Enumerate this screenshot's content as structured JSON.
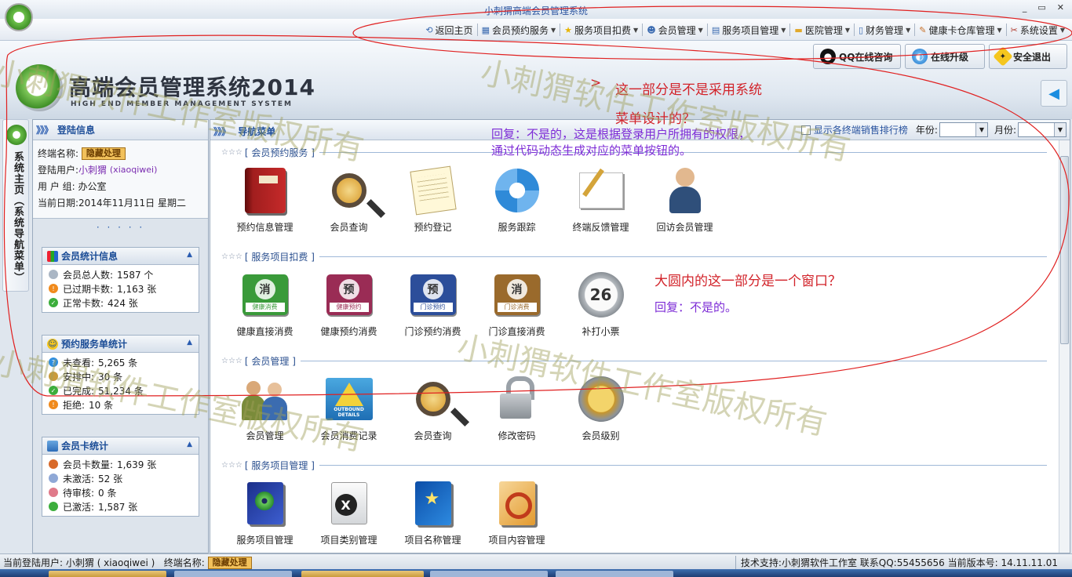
{
  "window": {
    "title": "小刺猬高端会员管理系统",
    "controls": [
      "_",
      "▭",
      "✕"
    ]
  },
  "menu": [
    {
      "label": "返回主页",
      "icon": "home-icon",
      "caret": false
    },
    {
      "label": "会员预约服务",
      "icon": "calendar-icon",
      "caret": true
    },
    {
      "label": "服务项目扣费",
      "icon": "star-icon",
      "caret": true
    },
    {
      "label": "会员管理",
      "icon": "user-icon",
      "caret": true
    },
    {
      "label": "服务项目管理",
      "icon": "list-icon",
      "caret": true
    },
    {
      "label": "医院管理",
      "icon": "folder-icon",
      "caret": true
    },
    {
      "label": "财务管理",
      "icon": "document-icon",
      "caret": true
    },
    {
      "label": "健康卡仓库管理",
      "icon": "tag-icon",
      "caret": true
    },
    {
      "label": "系统设置",
      "icon": "tools-icon",
      "caret": true
    }
  ],
  "header": {
    "logo_title": "高端会员管理系统2014",
    "logo_subtitle": "HIGH END MEMBER MANAGEMENT SYSTEM",
    "buttons": {
      "qq": "QQ在线咨询",
      "upgrade": "在线升级",
      "logout": "安全退出"
    }
  },
  "side_tab": {
    "label": "系统主页（系统导航菜单）"
  },
  "login_panel": {
    "title": "登陆信息",
    "terminal_label": "终端名称:",
    "terminal_value": "隐藏处理",
    "user_label": "登陆用户:",
    "user_name": "小刺猬",
    "user_account": "(xiaoqiwei)",
    "group_label": "用 户 组:",
    "group_value": "办公室",
    "date_label": "当前日期:",
    "date_value": "2014年11月11日 星期二",
    "dots": "· · · · ·"
  },
  "member_stats": {
    "title": "会员统计信息",
    "rows": [
      {
        "label": "会员总人数:",
        "value": "1587 个"
      },
      {
        "label": "已过期卡数:",
        "value": "1,163 张"
      },
      {
        "label": "正常卡数:",
        "value": "424 张"
      }
    ]
  },
  "booking_stats": {
    "title": "预约服务单统计",
    "rows": [
      {
        "label": "未查看:",
        "value": "5,265 条"
      },
      {
        "label": "安排中:",
        "value": "30 条"
      },
      {
        "label": "已完成:",
        "value": "51,234 条"
      },
      {
        "label": "拒绝:",
        "value": "10 条"
      }
    ]
  },
  "card_stats": {
    "title": "会员卡统计",
    "rows": [
      {
        "label": "会员卡数量:",
        "value": "1,639 张"
      },
      {
        "label": "未激活:",
        "value": "52 张"
      },
      {
        "label": "待审核:",
        "value": "0 条"
      },
      {
        "label": "已激活:",
        "value": "1,587 张"
      }
    ]
  },
  "main": {
    "title": "导航菜单",
    "filter": {
      "checkbox_label": "显示各终端销售排行榜",
      "year_label": "年份:",
      "month_label": "月份:"
    },
    "sections": [
      {
        "title": "会员预约服务",
        "items": [
          {
            "label": "预约信息管理",
            "icon": "red-book-icon"
          },
          {
            "label": "会员查询",
            "icon": "magnifier-icon"
          },
          {
            "label": "预约登记",
            "icon": "notepad-icon"
          },
          {
            "label": "服务跟踪",
            "icon": "arrows-icon"
          },
          {
            "label": "终端反馈管理",
            "icon": "writing-hand-icon"
          },
          {
            "label": "回访会员管理",
            "icon": "headset-person-icon"
          }
        ]
      },
      {
        "title": "服务项目扣费",
        "items": [
          {
            "label": "健康直接消费",
            "icon": "ticket-health-direct-icon",
            "glyph": "消",
            "caption": "健康消费",
            "color": "#3a9a3a"
          },
          {
            "label": "健康预约消费",
            "icon": "ticket-health-booking-icon",
            "glyph": "预",
            "caption": "健康预约",
            "color": "#9a2c55"
          },
          {
            "label": "门诊预约消费",
            "icon": "ticket-clinic-booking-icon",
            "glyph": "预",
            "caption": "门诊预约",
            "color": "#2c4e9a"
          },
          {
            "label": "门诊直接消费",
            "icon": "ticket-clinic-direct-icon",
            "glyph": "消",
            "caption": "门诊消费",
            "color": "#9a6a2c"
          },
          {
            "label": "补打小票",
            "icon": "calendar-26-icon",
            "glyph": "26"
          }
        ]
      },
      {
        "title": "会员管理",
        "items": [
          {
            "label": "会员管理",
            "icon": "people-icon"
          },
          {
            "label": "会员消费记录",
            "icon": "outbound-details-icon",
            "caption": "OUTBOUND DETAILS"
          },
          {
            "label": "会员查询",
            "icon": "magnifier-icon"
          },
          {
            "label": "修改密码",
            "icon": "lock-icon"
          },
          {
            "label": "会员级别",
            "icon": "coin-icon"
          }
        ]
      },
      {
        "title": "服务项目管理",
        "items": [
          {
            "label": "服务项目管理",
            "icon": "cd-box-icon"
          },
          {
            "label": "项目类别管理",
            "icon": "x-box-icon"
          },
          {
            "label": "项目名称管理",
            "icon": "blue-box-icon"
          },
          {
            "label": "项目内容管理",
            "icon": "orange-box-icon"
          }
        ]
      }
    ]
  },
  "annotations": {
    "q1_line1": "这一部分是不是采用系统",
    "q1_line2": "菜单设计的？",
    "a1_line1": "回复：不是的，这是根据登录用户所拥有的权限，",
    "a1_line2": "通过代码动态生成对应的菜单按钮的。",
    "q2": "大圆内的这一部分是一个窗口？",
    "a2": "回复：不是的。",
    "arrow": ">"
  },
  "watermark": "小刺猬软件工作室版权所有",
  "status": {
    "user_label": "当前登陆用户:",
    "user_value": "小刺猬 ( xiaoqiwei )",
    "terminal_label": "终端名称:",
    "terminal_value": "隐藏处理",
    "right": "技术支持:小刺猬软件工作室 联系QQ:55455656 当前版本号: 14.11.11.01"
  },
  "colors": {
    "accent": "#1f4f99",
    "annotation_red": "#d2232a",
    "annotation_violet": "#7d2cd6"
  }
}
